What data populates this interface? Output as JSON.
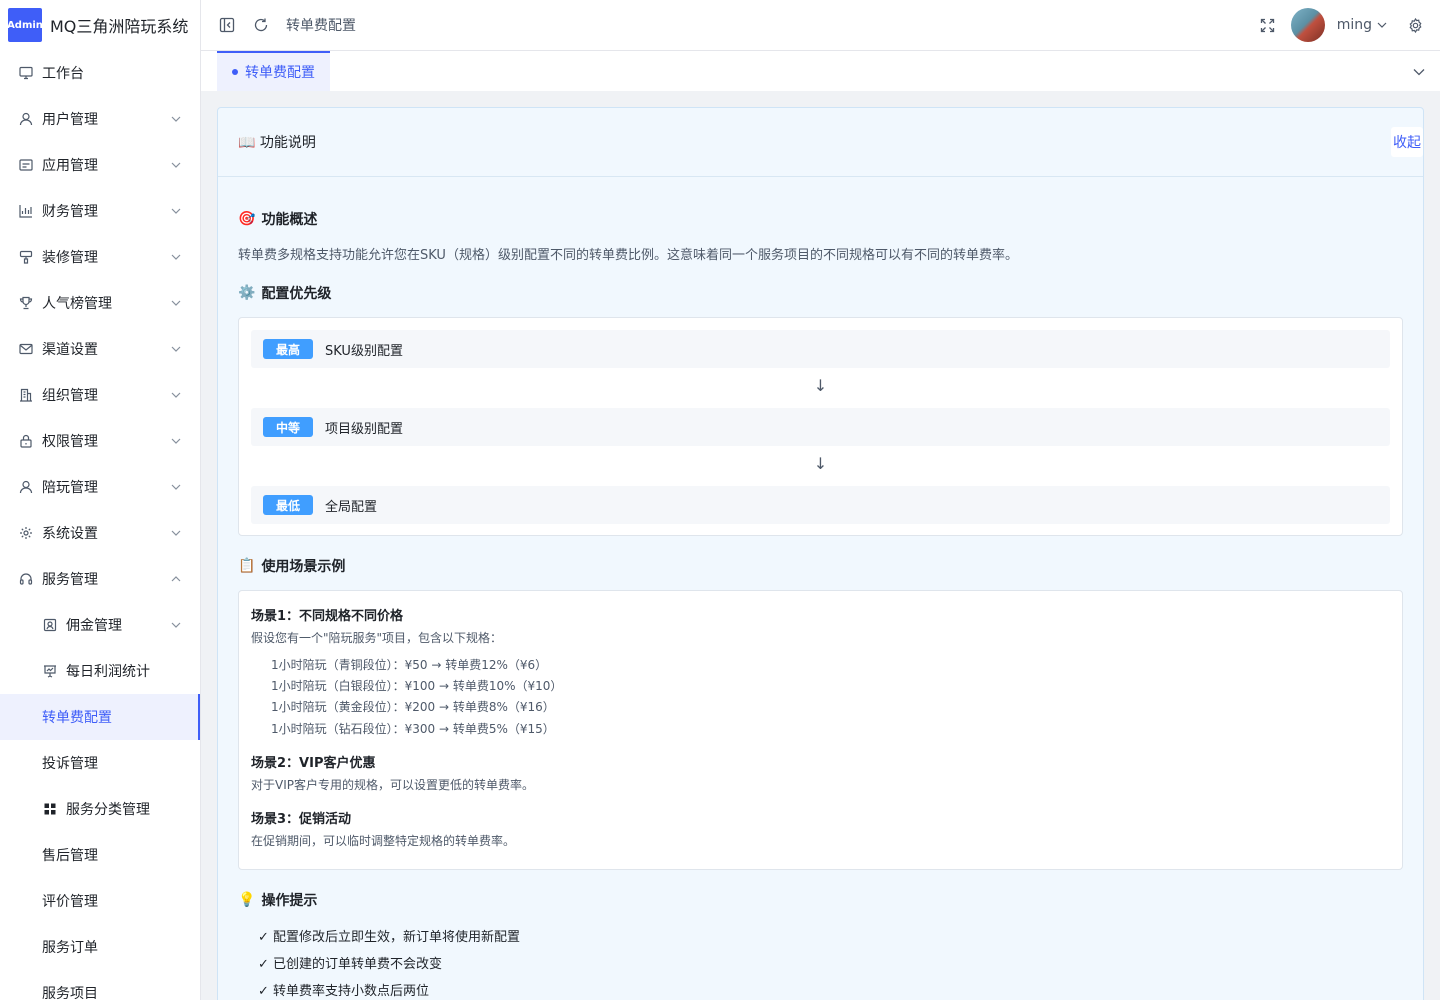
{
  "app": {
    "logo_badge": "Admin",
    "title": "MQ三角洲陪玩系统"
  },
  "sidebar": {
    "items": [
      {
        "label": "工作台"
      },
      {
        "label": "用户管理"
      },
      {
        "label": "应用管理"
      },
      {
        "label": "财务管理"
      },
      {
        "label": "装修管理"
      },
      {
        "label": "人气榜管理"
      },
      {
        "label": "渠道设置"
      },
      {
        "label": "组织管理"
      },
      {
        "label": "权限管理"
      },
      {
        "label": "陪玩管理"
      },
      {
        "label": "系统设置"
      },
      {
        "label": "服务管理"
      },
      {
        "label": "佣金管理"
      },
      {
        "label": "每日利润统计"
      },
      {
        "label": "转单费配置"
      },
      {
        "label": "投诉管理"
      },
      {
        "label": "服务分类管理"
      },
      {
        "label": "售后管理"
      },
      {
        "label": "评价管理"
      },
      {
        "label": "服务订单"
      },
      {
        "label": "服务项目"
      }
    ]
  },
  "header": {
    "breadcrumb": "转单费配置",
    "user_name": "ming"
  },
  "tabs": [
    {
      "label": "转单费配置"
    }
  ],
  "card": {
    "title": "功能说明",
    "title_emoji": "📖",
    "collapse_label": "收起",
    "overview": {
      "emoji": "🎯",
      "title": "功能概述",
      "text": "转单费多规格支持功能允许您在SKU（规格）级别配置不同的转单费比例。这意味着同一个服务项目的不同规格可以有不同的转单费率。"
    },
    "priority": {
      "emoji": "⚙️",
      "title": "配置优先级",
      "rows": [
        {
          "badge": "最高",
          "label": "SKU级别配置"
        },
        {
          "badge": "中等",
          "label": "项目级别配置"
        },
        {
          "badge": "最低",
          "label": "全局配置"
        }
      ],
      "arrow": "↓"
    },
    "scenarios": {
      "emoji": "📋",
      "title": "使用场景示例",
      "s1_title": "场景1：不同规格不同价格",
      "s1_text": "假设您有一个\"陪玩服务\"项目，包含以下规格：",
      "s1_items": [
        "1小时陪玩（青铜段位）：¥50 → 转单费12%（¥6）",
        "1小时陪玩（白银段位）：¥100 → 转单费10%（¥10）",
        "1小时陪玩（黄金段位）：¥200 → 转单费8%（¥16）",
        "1小时陪玩（钻石段位）：¥300 → 转单费5%（¥15）"
      ],
      "s2_title": "场景2：VIP客户优惠",
      "s2_text": "对于VIP客户专用的规格，可以设置更低的转单费率。",
      "s3_title": "场景3：促销活动",
      "s3_text": "在促销期间，可以临时调整特定规格的转单费率。"
    },
    "tips": {
      "emoji": "💡",
      "title": "操作提示",
      "items": [
        "✓ 配置修改后立即生效，新订单将使用新配置",
        "✓ 已创建的订单转单费不会改变",
        "✓ 转单费率支持小数点后两位"
      ]
    }
  }
}
